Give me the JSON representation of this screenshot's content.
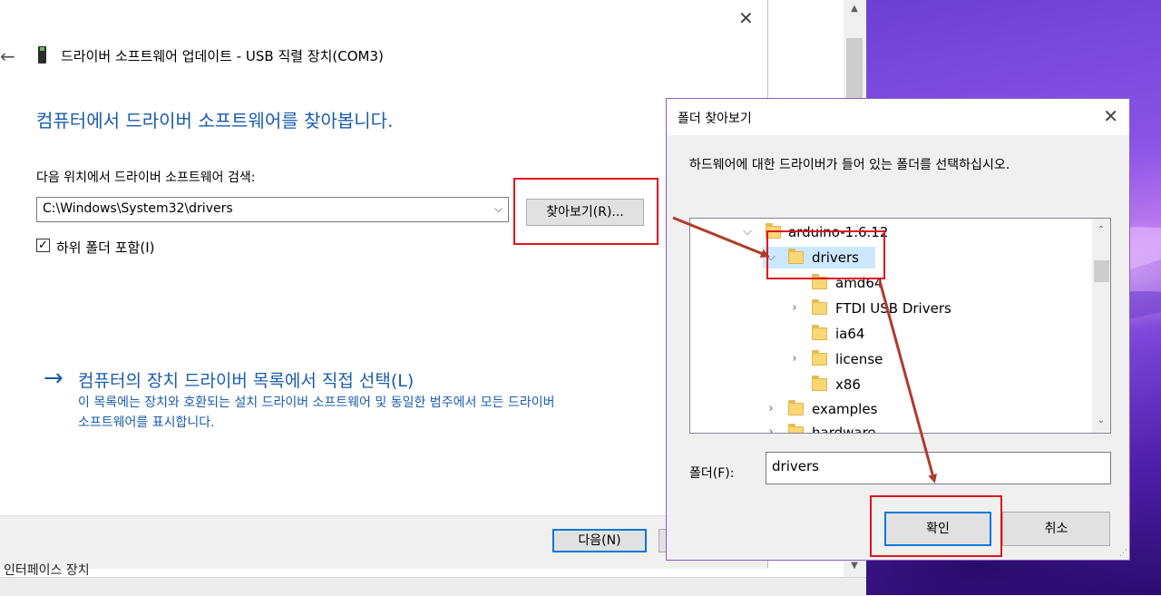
{
  "update_dialog": {
    "title": "드라이버 소프트웨어 업데이트 - USB 직렬 장치(COM3)",
    "heading": "컴퓨터에서 드라이버 소프트웨어를 찾아봅니다.",
    "search_label": "다음 위치에서 드라이버 소프트웨어 검색:",
    "path_value": "C:\\Windows\\System32\\drivers",
    "browse_button": "찾아보기(R)...",
    "include_subfolders": "하위 폴더 포함(I)",
    "include_subfolders_checked": true,
    "manual_link": "컴퓨터의 장치 드라이버 목록에서 직접 선택(L)",
    "manual_desc_line1": "이 목록에는 장치와 호환되는 설치 드라이버 소프트웨어 및 동일한 범주에서 모든 드라이버",
    "manual_desc_line2": "소프트웨어를 표시합니다.",
    "next_button": "다음(N)",
    "bottom_text": "인터페이스 장치"
  },
  "browse_dialog": {
    "title": "폴더 찾아보기",
    "instruction": "하드웨어에 대한 드라이버가 들어 있는 폴더를 선택하십시오.",
    "tree": [
      {
        "label": "arduino-1.6.12",
        "toggle": "expanded",
        "depth": 0
      },
      {
        "label": "drivers",
        "toggle": "expanded",
        "depth": 1,
        "selected": true
      },
      {
        "label": "amd64",
        "toggle": "none",
        "depth": 2
      },
      {
        "label": "FTDI USB Drivers",
        "toggle": "collapsed",
        "depth": 2
      },
      {
        "label": "ia64",
        "toggle": "none",
        "depth": 2
      },
      {
        "label": "license",
        "toggle": "collapsed",
        "depth": 2
      },
      {
        "label": "x86",
        "toggle": "none",
        "depth": 2
      },
      {
        "label": "examples",
        "toggle": "collapsed",
        "depth": 1
      },
      {
        "label": "hardware",
        "toggle": "collapsed",
        "depth": 1
      }
    ],
    "folder_label": "폴더(F):",
    "folder_value": "drivers",
    "ok_button": "확인",
    "cancel_button": "취소"
  },
  "icons": {
    "back": "←",
    "close": "✕",
    "checkmark": "✓",
    "chevron_down": "⌵",
    "manual_arrow": "→"
  },
  "colors": {
    "link_blue": "#1a5dab",
    "accent": "#0078d7",
    "annotation_red": "#e0141e",
    "annotation_arrow": "#b23a2a",
    "selection": "#cce8ff",
    "dialog_border": "#8a5cc6"
  }
}
